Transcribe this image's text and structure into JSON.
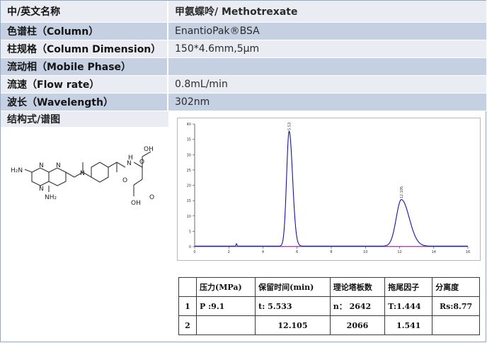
{
  "table": {
    "header": {
      "label": "中/英文名称",
      "value": "甲氨蝶呤/ Methotrexate"
    },
    "rows": [
      {
        "label": "色谱柱（Column）",
        "value": "EnantioPak®BSA"
      },
      {
        "label": "柱规格（Column Dimension）",
        "value": "150*4.6mm,5μm"
      },
      {
        "label": "流动相（Mobile Phase）",
        "value": ""
      },
      {
        "label": "流速（Flow rate）",
        "value": "0.8mL/min"
      },
      {
        "label": "波长（Wavelength）",
        "value": "302nm"
      }
    ],
    "structure_label": "结构式/谱图"
  },
  "molecule": {
    "labels": [
      "OH",
      "O",
      "N",
      "H",
      "H₂N",
      "N",
      "N",
      "N",
      "N",
      "NH₂",
      "O",
      "OH",
      "O"
    ]
  },
  "chart_data": {
    "type": "line",
    "xlim": [
      0,
      16
    ],
    "ylim": [
      0,
      40
    ],
    "x_ticks": [
      "0",
      "2",
      "4",
      "6",
      "8",
      "10",
      "12",
      "14",
      "16"
    ],
    "y_ticks": [
      "0",
      "5",
      "10",
      "15",
      "20",
      "25",
      "30",
      "35",
      "40"
    ],
    "grid": false,
    "peaks": [
      {
        "rt": 5.533,
        "height": 37.5,
        "width": 0.15,
        "tail": 0.2,
        "label": "5.53"
      },
      {
        "rt": 12.105,
        "height": 15.2,
        "width": 0.3,
        "tail": 0.46,
        "label": "12.105"
      }
    ],
    "baseline_disturbance": {
      "x": 2.45,
      "height": 0.8
    },
    "line_color": "#1414a0",
    "baseline_color": "#d63cd6"
  },
  "results": {
    "headers": [
      "",
      "压力(MPa)",
      "保留时间(min)",
      "理论塔板数",
      "拖尾因子",
      "分离度"
    ],
    "rows": [
      [
        "1",
        "P :9.1",
        "t: 5.533",
        "n： 2642",
        "T:1.444",
        "Rs:8.77"
      ],
      [
        "2",
        "",
        "12.105",
        "2066",
        "1.541",
        ""
      ]
    ]
  }
}
